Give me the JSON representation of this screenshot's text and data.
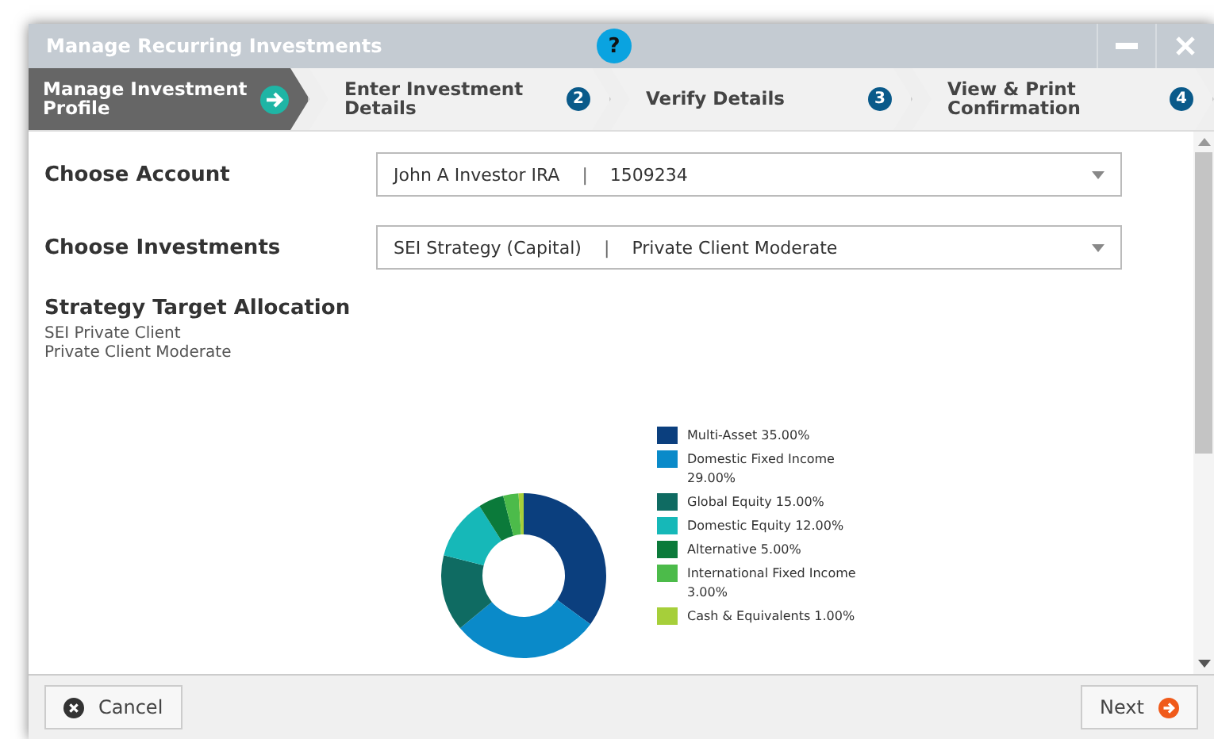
{
  "window": {
    "title": "Manage Recurring Investments",
    "help": "?"
  },
  "steps": [
    {
      "label": "Manage Investment Profile",
      "selected": true
    },
    {
      "label": "Enter Investment Details",
      "number": "2",
      "selected": false
    },
    {
      "label": "Verify Details",
      "number": "3",
      "selected": false
    },
    {
      "label": "View & Print Confirmation",
      "number": "4",
      "selected": false
    }
  ],
  "fields": [
    {
      "label": "Choose Account",
      "value": "John A Investor IRA",
      "separator": "|",
      "detail": "1509234"
    },
    {
      "label": "Choose Investments",
      "value": "SEI Strategy (Capital)",
      "separator": "|",
      "detail": "Private Client Moderate"
    }
  ],
  "allocation": {
    "title": "Strategy Target Allocation",
    "lines": [
      "SEI Private Client",
      "Private Client Moderate"
    ],
    "chart_data": {
      "type": "donut",
      "categories": [
        "Multi-Asset",
        "Domestic Fixed Income",
        "Global Equity",
        "Domestic Equity",
        "Alternative",
        "International Fixed Income",
        "Cash & Equivalents"
      ],
      "series": [
        {
          "values": [
            35,
            29,
            15,
            12,
            5,
            3,
            1
          ]
        }
      ],
      "legend": "right",
      "colors": [
        "#0b3f7e",
        "#0a8ac9",
        "#0f6b62",
        "#16b8b8",
        "#0b7a3a",
        "#4cbb4a",
        "#a6cf3a"
      ],
      "value_labels": [
        "35.00%",
        "29.00%",
        "15.00%",
        "12.00%",
        "5.00%",
        "3.00%",
        "1.00%"
      ]
    }
  },
  "buttons": [
    {
      "label": "Cancel",
      "kind": "cancel"
    },
    {
      "label": "Next",
      "kind": "next"
    }
  ]
}
